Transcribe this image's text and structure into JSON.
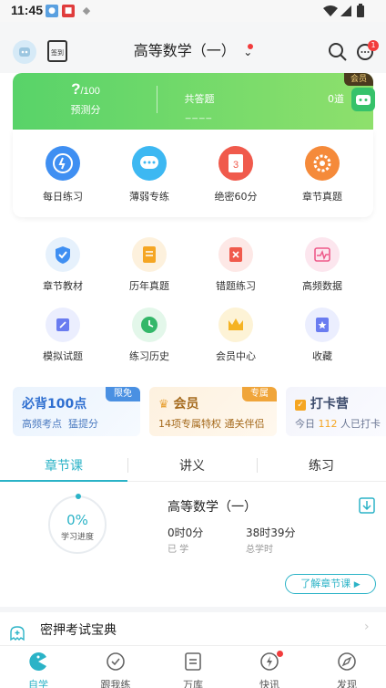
{
  "status_bar": {
    "time": "11:45"
  },
  "header": {
    "title": "高等数学（一）",
    "signin_label": "签到",
    "message_badge": "1"
  },
  "stats": {
    "predicted_score_value": "?",
    "predicted_score_suffix": "/100",
    "predicted_score_label": "预测分",
    "total_answered_label": "共答题",
    "total_answered_value": "____",
    "count_value": "0道",
    "vip_tag": "会员"
  },
  "quick_actions": [
    {
      "label": "每日练习",
      "icon": "lightning-icon",
      "color": "#3f8ff2"
    },
    {
      "label": "薄弱专练",
      "icon": "chat-bubble-icon",
      "color": "#3db8f2"
    },
    {
      "label": "绝密60分",
      "icon": "calendar-3-icon",
      "color": "#f05a4c"
    },
    {
      "label": "章节真题",
      "icon": "gear-icon",
      "color": "#f58a3a"
    }
  ],
  "grid": [
    {
      "label": "章节教材",
      "icon": "shield-icon",
      "color": "#e6f1fc",
      "fg": "#3f8ff2"
    },
    {
      "label": "历年真题",
      "icon": "document-icon",
      "color": "#fdf1dd",
      "fg": "#f5a623"
    },
    {
      "label": "错题练习",
      "icon": "error-card-icon",
      "color": "#fde8e6",
      "fg": "#f05a4c"
    },
    {
      "label": "高频数据",
      "icon": "pulse-icon",
      "color": "#fce6ee",
      "fg": "#ee5a8a"
    },
    {
      "label": "模拟试题",
      "icon": "edit-icon",
      "color": "#ebeefe",
      "fg": "#6a7cf0"
    },
    {
      "label": "练习历史",
      "icon": "clock-icon",
      "color": "#e3f7ea",
      "fg": "#33b769"
    },
    {
      "label": "会员中心",
      "icon": "crown-icon",
      "color": "#fdf3d6",
      "fg": "#f5b323"
    },
    {
      "label": "收藏",
      "icon": "star-icon",
      "color": "#ebeefe",
      "fg": "#6a7cf0"
    }
  ],
  "promos": [
    {
      "title": "必背100点",
      "sub_a": "高频考点",
      "sub_b": "猛提分",
      "tag": "限免"
    },
    {
      "title": "会员",
      "sub_a": "14项专属特权",
      "sub_b": "通关伴侣",
      "tag": "专属"
    },
    {
      "title": "打卡营",
      "sub_a": "今日",
      "sub_count": "112",
      "sub_b": "人已打卡"
    }
  ],
  "tabs": [
    "章节课",
    "讲义",
    "练习"
  ],
  "course": {
    "progress_value": "0%",
    "progress_label": "学习进度",
    "name": "高等数学（一）",
    "learned_value": "0时0分",
    "learned_label": "已 学",
    "total_value": "38时39分",
    "total_label": "总学时",
    "more_button": "了解章节课"
  },
  "promo_bar": {
    "label": "密押考试宝典"
  },
  "bottom_nav": [
    {
      "label": "自学",
      "icon": "pacman-icon",
      "active": true
    },
    {
      "label": "跟我练",
      "icon": "check-circle-icon",
      "active": false
    },
    {
      "label": "万库",
      "icon": "library-icon",
      "active": false
    },
    {
      "label": "快讯",
      "icon": "bolt-icon",
      "active": false
    },
    {
      "label": "发现",
      "icon": "compass-icon",
      "active": false
    }
  ],
  "colors": {
    "accent": "#2bb3c7",
    "green": "#58d369"
  }
}
